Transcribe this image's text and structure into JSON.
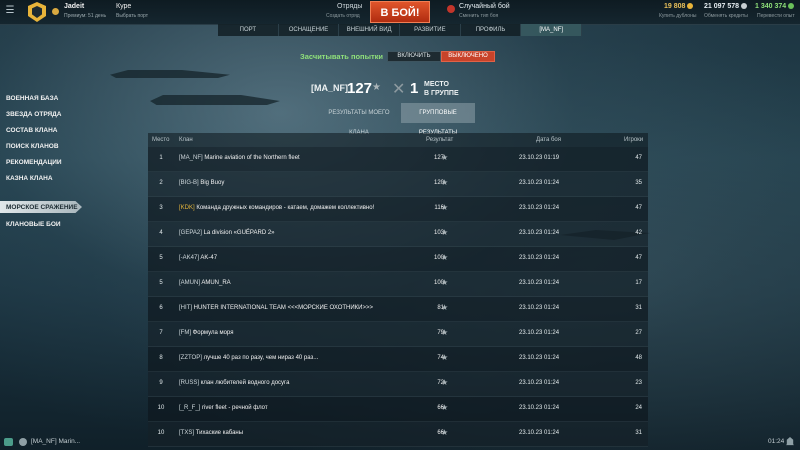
{
  "topbar": {
    "user_name": "Jadeit",
    "user_sub": "Премиум: 51 день",
    "port_name": "Куре",
    "port_sub": "Выбрать порт",
    "squad_label": "Отряды",
    "squad_sub": "Создать отряд",
    "battle_button": "В БОЙ!",
    "mode_label": "Случайный бой",
    "mode_sub": "Сменить тип боя",
    "doubloons": "19 808",
    "doubloons_sub": "Купить дублоны",
    "credits": "21 097 578",
    "credits_sub": "Обменять кредиты",
    "free_xp": "1 340 374",
    "free_xp_sub": "Перевести опыт"
  },
  "nav": {
    "tabs": [
      {
        "label": "ПОРТ"
      },
      {
        "label": "ОСНАЩЕНИЕ"
      },
      {
        "label": "ВНЕШНИЙ ВИД"
      },
      {
        "label": "РАЗВИТИЕ"
      },
      {
        "label": "ПРОФИЛЬ"
      },
      {
        "label": "[MA_NF]"
      }
    ],
    "active_index": 5
  },
  "sidebar": {
    "items": [
      {
        "label": "ВОЕННАЯ БАЗА"
      },
      {
        "label": "ЗВЕЗДА ОТРЯДА"
      },
      {
        "label": "СОСТАВ КЛАНА"
      },
      {
        "label": "ПОИСК КЛАНОВ"
      },
      {
        "label": "РЕКОМЕНДАЦИИ"
      },
      {
        "label": "КАЗНА КЛАНА"
      },
      {
        "label": "МОРСКОЕ СРАЖЕНИЕ"
      },
      {
        "label": "КЛАНОВЫЕ БОИ"
      }
    ],
    "active_index": 6
  },
  "toggle": {
    "label": "Засчитывать попытки",
    "on_label": "ВКЛЮЧИТЬ",
    "off_label": "ВЫКЛЮЧЕНО"
  },
  "summary": {
    "clan_tag": "[MA_NF]",
    "score": "127",
    "place": "1",
    "place_line1": "МЕСТО",
    "place_line2": "В ГРУППЕ"
  },
  "result_tabs": {
    "my_clan": "РЕЗУЛЬТАТЫ МОЕГО КЛАНА",
    "group": "ГРУППОВЫЕ РЕЗУЛЬТАТЫ"
  },
  "table": {
    "headers": {
      "place": "Место",
      "clan": "Клан",
      "result": "Результат",
      "date": "Дата боя",
      "players": "Игроки"
    },
    "rows": [
      {
        "place": "1",
        "tag": "[MA_NF]",
        "name": "Marine aviation of the Northern fleet",
        "score": "127",
        "date": "23.10.23 01:19",
        "players": "47",
        "gold": false
      },
      {
        "place": "2",
        "tag": "[BIG-B]",
        "name": "Big Buoy",
        "score": "120",
        "date": "23.10.23 01:24",
        "players": "35",
        "gold": false
      },
      {
        "place": "3",
        "tag": "[KDK]",
        "name": "Команда дружных командиров - катаем, домажем коллективно!",
        "score": "116",
        "date": "23.10.23 01:24",
        "players": "47",
        "gold": true
      },
      {
        "place": "4",
        "tag": "[GEPA2]",
        "name": "La division «GUÉPARD 2»",
        "score": "103",
        "date": "23.10.23 01:24",
        "players": "42",
        "gold": false
      },
      {
        "place": "5",
        "tag": "[-AK47]",
        "name": "AK-47",
        "score": "100",
        "date": "23.10.23 01:24",
        "players": "47",
        "gold": false
      },
      {
        "place": "5",
        "tag": "[AMUN]",
        "name": "AMUN_RA",
        "score": "100",
        "date": "23.10.23 01:24",
        "players": "17",
        "gold": false
      },
      {
        "place": "6",
        "tag": "[HIT]",
        "name": "HUNTER INTERNATIONAL TEAM <<<МОРСКИЕ ОХОТНИКИ>>>",
        "score": "81",
        "date": "23.10.23 01:24",
        "players": "31",
        "gold": false
      },
      {
        "place": "7",
        "tag": "[FM]",
        "name": "Формула моря",
        "score": "79",
        "date": "23.10.23 01:24",
        "players": "27",
        "gold": false
      },
      {
        "place": "8",
        "tag": "[ZZTOP]",
        "name": "лучше 40 раз по разу, чем нираз 40 раз...",
        "score": "74",
        "date": "23.10.23 01:24",
        "players": "48",
        "gold": false
      },
      {
        "place": "9",
        "tag": "[RUSS]",
        "name": "клан любителей водного досуга",
        "score": "72",
        "date": "23.10.23 01:24",
        "players": "23",
        "gold": false
      },
      {
        "place": "10",
        "tag": "[_R_F_]",
        "name": "river fleet - речной флот",
        "score": "66",
        "date": "23.10.23 01:24",
        "players": "24",
        "gold": false
      },
      {
        "place": "10",
        "tag": "[TXS]",
        "name": "Тихаские кабаны",
        "score": "66",
        "date": "23.10.23 01:24",
        "players": "31",
        "gold": false
      }
    ]
  },
  "bottom": {
    "chat_label": "[MA_NF] Marin...",
    "clock": "01:24"
  },
  "colors": {
    "battle": "#c9401f",
    "accent_green": "#8fe07a",
    "gold_tag": "#e5b53b"
  }
}
